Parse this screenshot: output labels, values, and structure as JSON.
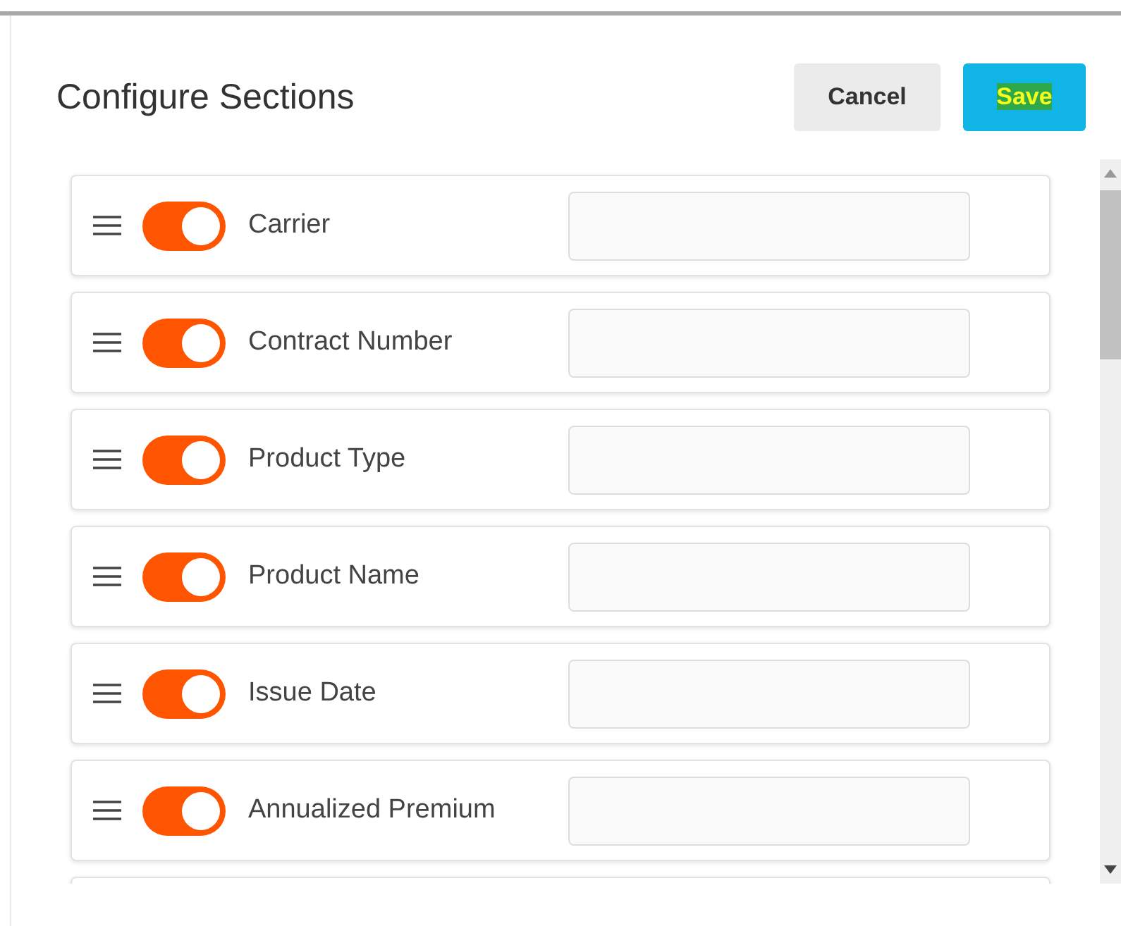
{
  "dialog": {
    "title": "Configure Sections"
  },
  "buttons": [
    {
      "label": "Cancel",
      "kind": "secondary"
    },
    {
      "label": "Save",
      "kind": "primary"
    }
  ],
  "sections": [
    {
      "name": "Carrier",
      "on": true
    },
    {
      "name": "Contract Number",
      "on": true
    },
    {
      "name": "Product Type",
      "on": true
    },
    {
      "name": "Product Name",
      "on": true
    },
    {
      "name": "Issue Date",
      "on": true
    },
    {
      "name": "Annualized Premium",
      "on": true
    }
  ]
}
